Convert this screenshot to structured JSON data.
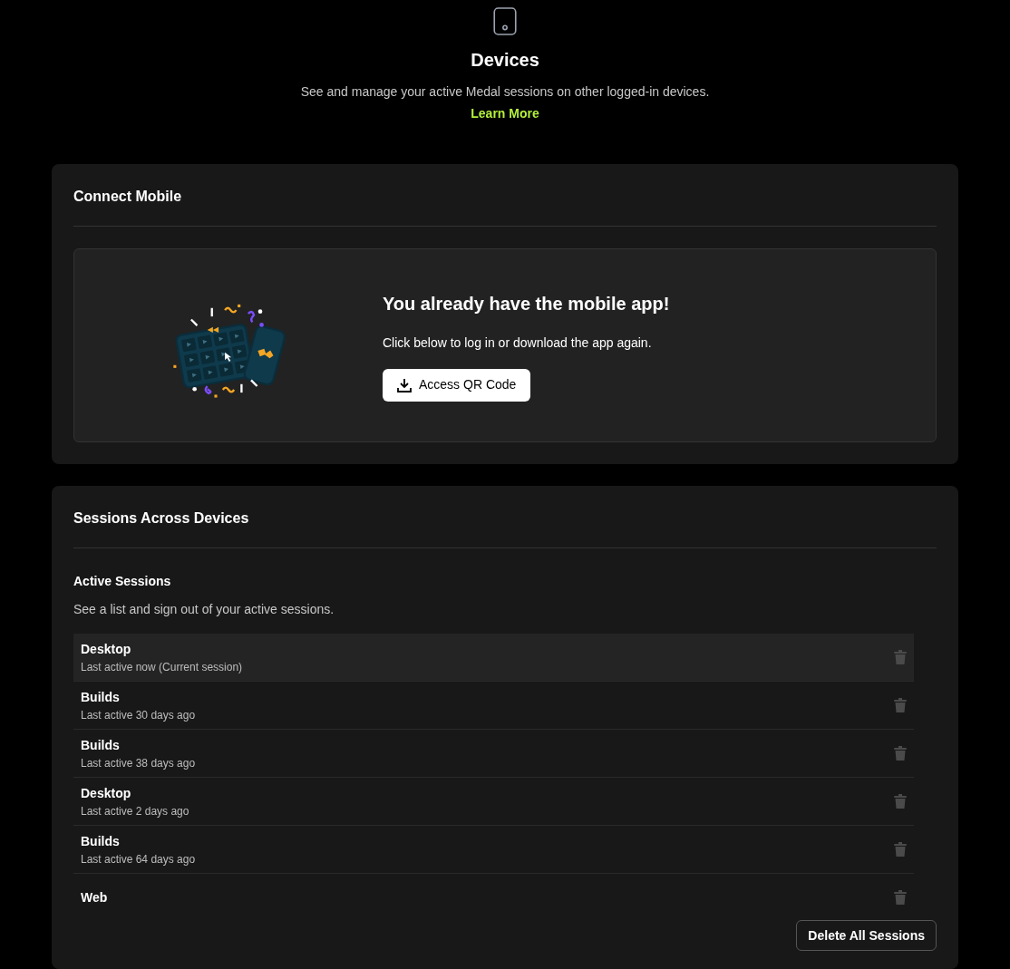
{
  "header": {
    "title": "Devices",
    "description": "See and manage your active Medal sessions on other logged-in devices.",
    "link": "Learn More"
  },
  "connect_mobile": {
    "title": "Connect Mobile",
    "heading": "You already have the mobile app!",
    "text": "Click below to log in or download the app again.",
    "button": "Access QR Code"
  },
  "sessions": {
    "title": "Sessions Across Devices",
    "subtitle": "Active Sessions",
    "description": "See a list and sign out of your active sessions.",
    "rows": [
      {
        "name": "Desktop",
        "detail": "Last active now (Current session)",
        "selected": true
      },
      {
        "name": "Builds",
        "detail": "Last active 30 days ago",
        "selected": false
      },
      {
        "name": "Builds",
        "detail": "Last active 38 days ago",
        "selected": false
      },
      {
        "name": "Desktop",
        "detail": "Last active 2 days ago",
        "selected": false
      },
      {
        "name": "Builds",
        "detail": "Last active 64 days ago",
        "selected": false
      },
      {
        "name": "Web",
        "selected": false
      }
    ],
    "button": "Delete All Sessions"
  }
}
